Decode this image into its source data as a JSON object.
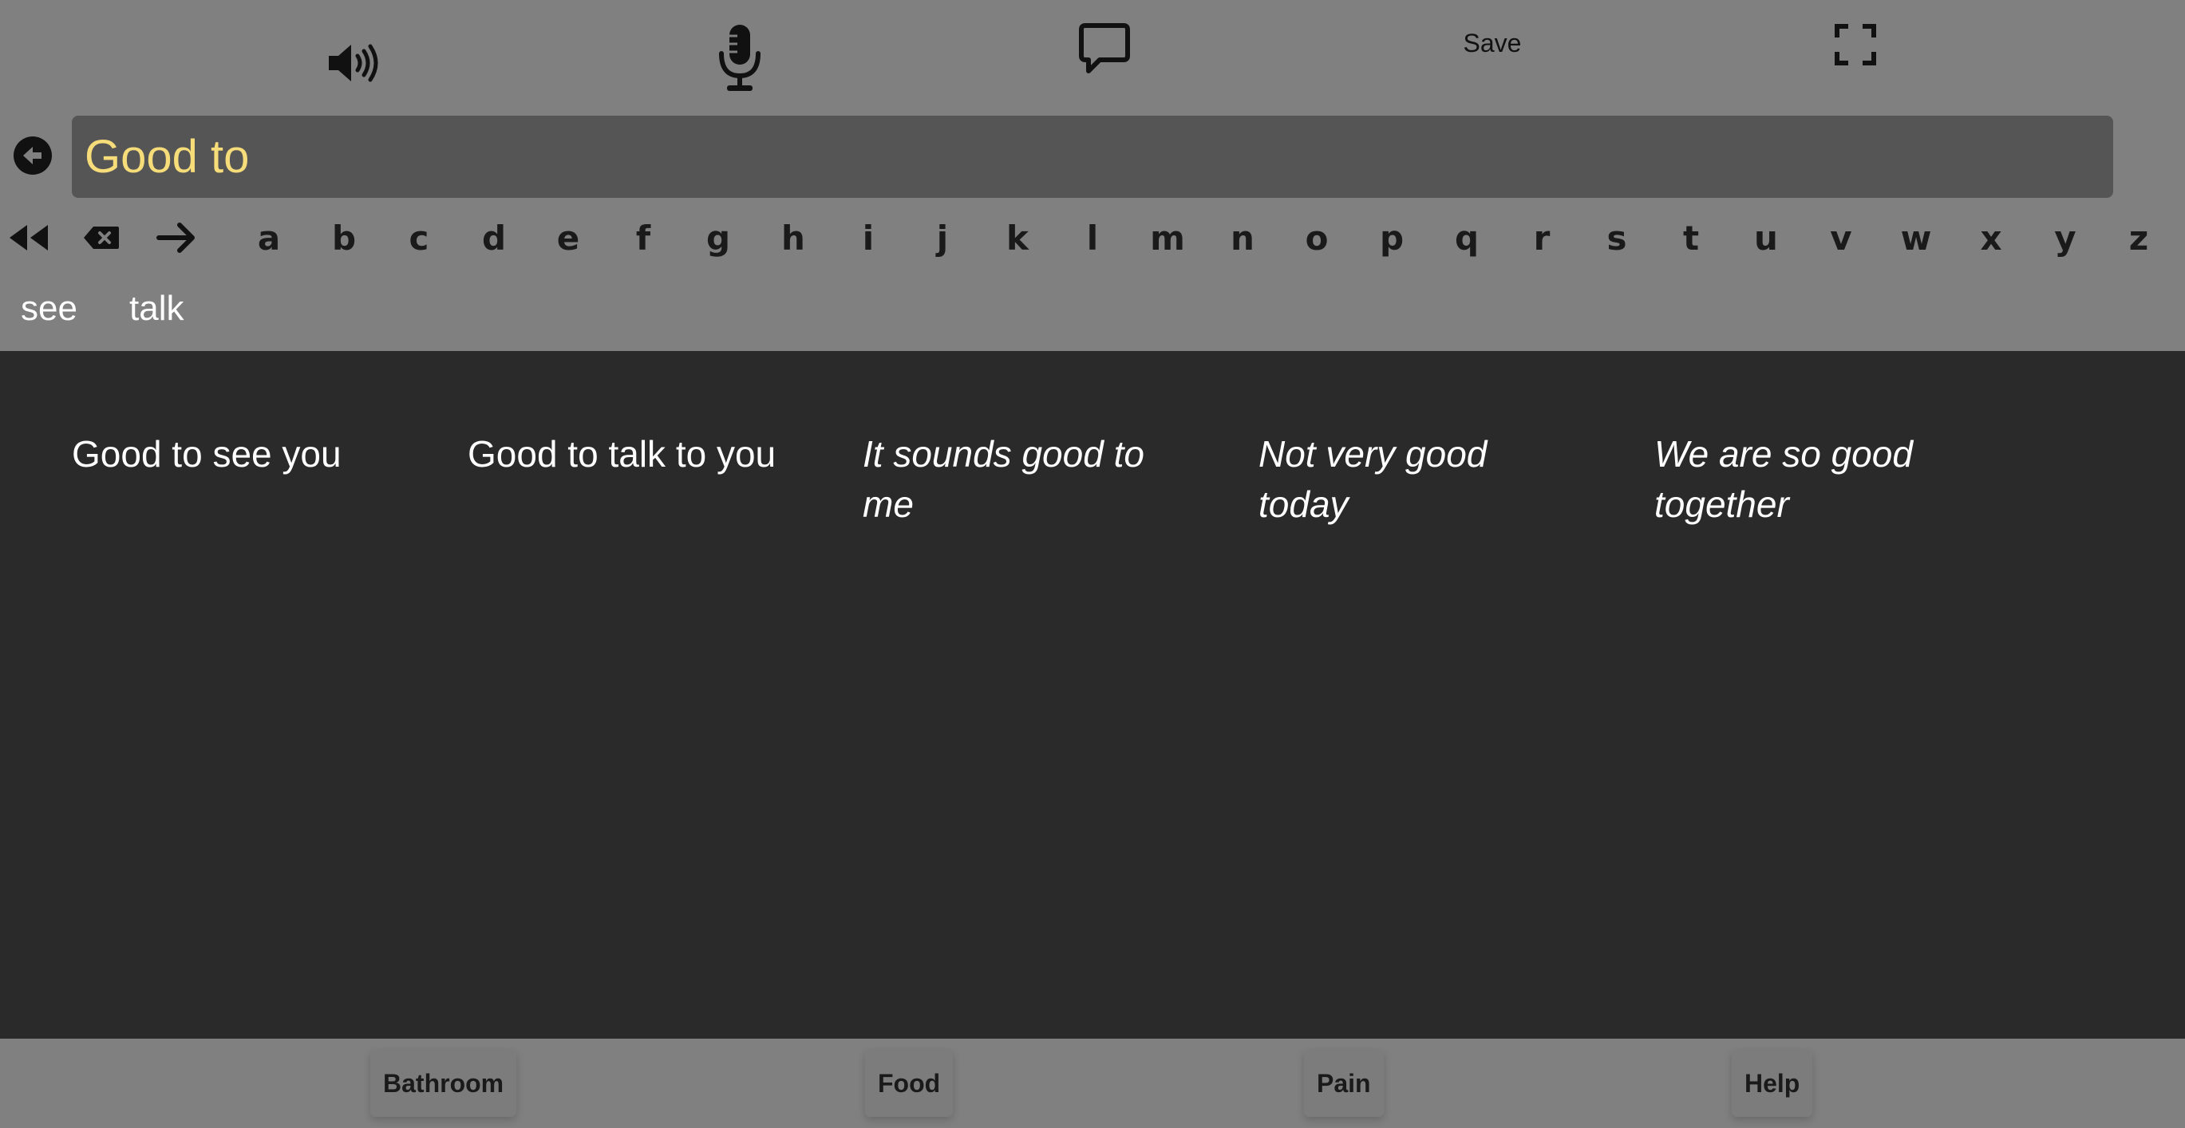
{
  "toolbar": {
    "speaker_icon": "speaker-volume-icon",
    "mic_icon": "microphone-icon",
    "chat_icon": "speech-bubble-icon",
    "save_label": "Save",
    "fullscreen_icon": "fullscreen-icon"
  },
  "input": {
    "text": "Good to",
    "text_color": "#f7dc7a"
  },
  "keyboard": {
    "letters": [
      "a",
      "b",
      "c",
      "d",
      "e",
      "f",
      "g",
      "h",
      "i",
      "j",
      "k",
      "l",
      "m",
      "n",
      "o",
      "p",
      "q",
      "r",
      "s",
      "t",
      "u",
      "v",
      "w",
      "x",
      "y",
      "z"
    ]
  },
  "word_suggestions": [
    "see",
    "talk"
  ],
  "phrases": [
    {
      "text": "Good to see you",
      "italic": false
    },
    {
      "text": "Good to talk to you",
      "italic": false
    },
    {
      "text": "It sounds good to me",
      "italic": true
    },
    {
      "text": "Not very good today",
      "italic": true
    },
    {
      "text": "We are so good together",
      "italic": true
    }
  ],
  "quick_buttons": [
    "Bathroom",
    "Food",
    "Pain",
    "Help"
  ],
  "colors": {
    "panel": "#808080",
    "background": "#2a2a2a",
    "input_bg": "#555555"
  }
}
